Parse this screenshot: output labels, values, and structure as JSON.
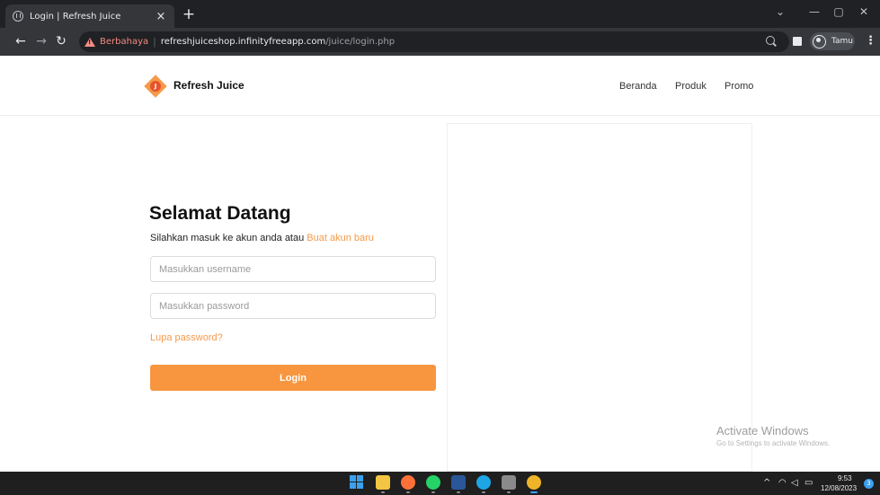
{
  "browser": {
    "tab": {
      "title": "Login | Refresh Juice",
      "close": "×"
    },
    "new_tab": "+",
    "window_controls": {
      "chevron": "⌄",
      "minimize": "—",
      "maximize": "▢",
      "close": "✕"
    },
    "nav": {
      "back": "←",
      "forward": "→",
      "reload": "↻"
    },
    "address": {
      "warning_label": "Berbahaya",
      "separator": "|",
      "host": "refreshjuiceshop.infinityfreeapp.com",
      "path": "/juice/login.php"
    },
    "profile_name": "Tamu",
    "menu": "⋮",
    "colors": {
      "warning": "#f28b82",
      "frame": "#202124",
      "toolbar": "#35363a"
    }
  },
  "site": {
    "brand": "Refresh Juice",
    "logo_letter": "J",
    "nav": [
      "Beranda",
      "Produk",
      "Promo"
    ],
    "accent_color": "#f7963f"
  },
  "login": {
    "title": "Selamat Datang",
    "subtitle": "Silahkan masuk ke akun anda atau ",
    "signup_link": "Buat akun baru",
    "username_placeholder": "Masukkan username",
    "username_value": "",
    "password_placeholder": "Masukkan password",
    "password_value": "",
    "forgot_link": "Lupa password?",
    "submit_label": "Login"
  },
  "watermark": {
    "title": "Activate Windows",
    "subtitle": "Go to Settings to activate Windows."
  },
  "taskbar": {
    "apps": [
      "windows-start-icon",
      "file-explorer-icon",
      "firefox-icon",
      "whatsapp-icon",
      "word-icon",
      "edge-icon",
      "store-icon",
      "chrome-icon"
    ],
    "tray_chevron": "^",
    "tray_icons": [
      "wifi-icon",
      "volume-icon",
      "battery-icon"
    ],
    "time": "9:53",
    "date": "12/08/2023",
    "notification_count": "3"
  }
}
